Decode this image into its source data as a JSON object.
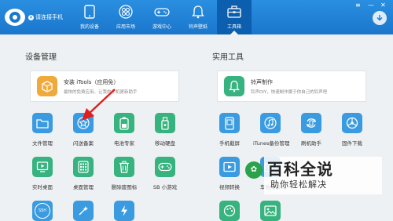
{
  "header": {
    "brand_status": "请连接手机",
    "status_icon": "close-icon",
    "nav": [
      {
        "label": "我的设备",
        "icon": "phone-icon",
        "active": false
      },
      {
        "label": "应用市场",
        "icon": "apps-clover-icon",
        "active": false
      },
      {
        "label": "游戏中心",
        "icon": "gamepad-icon",
        "active": false
      },
      {
        "label": "铃声壁纸",
        "icon": "bell-icon",
        "active": false
      },
      {
        "label": "工具箱",
        "icon": "toolbox-icon",
        "active": true
      }
    ],
    "window_controls": [
      "≡",
      "—",
      "✕"
    ],
    "download_icon": "download-icon"
  },
  "device_panel": {
    "title": "设备管理",
    "card": {
      "title": "安装 iTools（应用免）",
      "desc": "最快的免费应用，让我的手机更新助手",
      "icon": "box-icon",
      "color": "#f0a93b"
    },
    "tiles": [
      {
        "label": "文件管理",
        "icon": "folder-icon",
        "color": "#3a9be0"
      },
      {
        "label": "闪送备案",
        "icon": "star-badge-icon",
        "color": "#3a9be0"
      },
      {
        "label": "电池专家",
        "icon": "battery-icon",
        "color": "#36b37e"
      },
      {
        "label": "移动硬盘",
        "icon": "usb-drive-icon",
        "color": "#36b37e"
      },
      {
        "label": "实时桌面",
        "icon": "desktop-icon",
        "color": "#36b37e"
      },
      {
        "label": "桌面管理",
        "icon": "grid-icon",
        "color": "#36b37e"
      },
      {
        "label": "删除废图标",
        "icon": "trash-icon",
        "color": "#36b37e"
      },
      {
        "label": "SB 小游戏",
        "icon": "controller-icon",
        "color": "#36b37e"
      },
      {
        "label": "",
        "icon": "ssh-icon",
        "color": "#3a9be0",
        "badge": "SSH"
      },
      {
        "label": "",
        "icon": "magic-wand-icon",
        "color": "#3a9be0"
      },
      {
        "label": "",
        "icon": "flash-icon",
        "color": "#3a9be0"
      }
    ]
  },
  "tools_panel": {
    "title": "实用工具",
    "card": {
      "title": "铃声制作",
      "desc": "铃声DIY，快速制作属于你自己的铃声吧",
      "icon": "bell-icon",
      "color": "#36b37e"
    },
    "tiles": [
      {
        "label": "手机截屏",
        "icon": "screenshot-phone-icon",
        "color": "#3a9be0"
      },
      {
        "label": "iTunes备份管理",
        "icon": "music-note-icon",
        "color": "#3a9be0"
      },
      {
        "label": "刷机助手",
        "icon": "refresh-phone-icon",
        "color": "#3a9be0"
      },
      {
        "label": "固件下载",
        "icon": "steering-wheel-icon",
        "color": "#3a9be0"
      },
      {
        "label": "视频转换",
        "icon": "video-icon",
        "color": "#3a9be0"
      },
      {
        "label": "车载录屏",
        "icon": "camera-icon",
        "color": "#3a9be0"
      },
      {
        "label": "",
        "icon": "palette-icon",
        "color": "#36b37e"
      },
      {
        "label": "",
        "icon": "image-icon",
        "color": "#36b37e"
      }
    ]
  },
  "annotation": {
    "icon": "red-arrow-icon",
    "color": "#e02020"
  },
  "watermark": {
    "title": "百科全说",
    "subtitle": "助你轻松解决",
    "icon": "paw-icon"
  }
}
